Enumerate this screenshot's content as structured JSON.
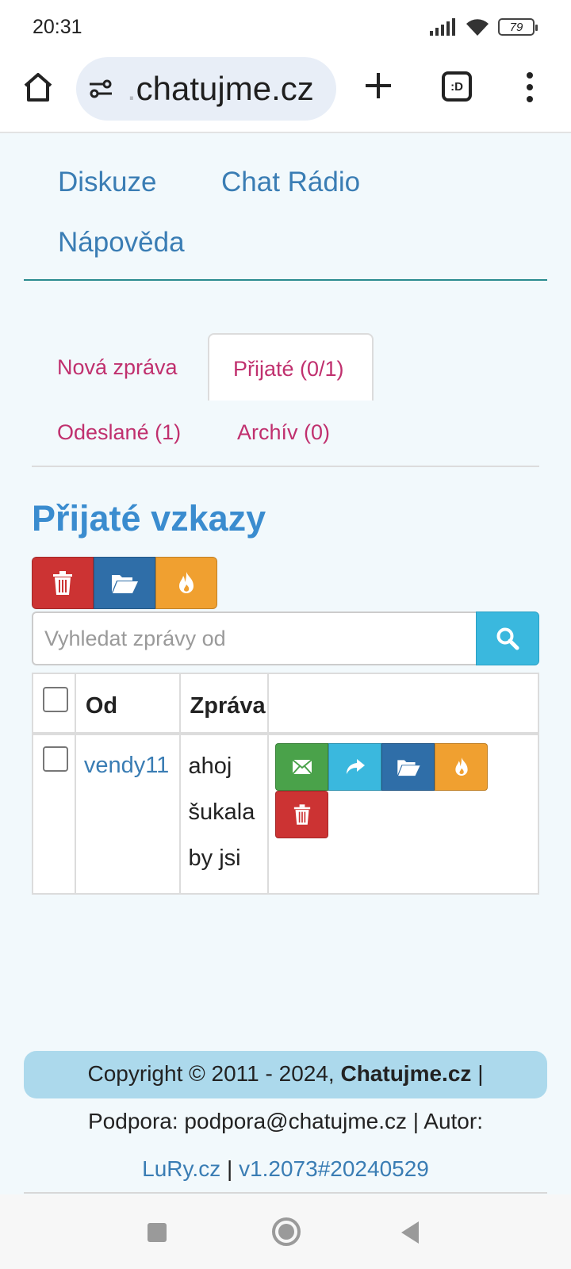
{
  "status_bar": {
    "time": "20:31",
    "battery": "79"
  },
  "browser": {
    "url_faded": ".",
    "url": "chatujme.cz",
    "tabs_label": ":D"
  },
  "site_nav": {
    "items": [
      "Diskuze",
      "Chat Rádio",
      "Nápověda"
    ]
  },
  "message_tabs": {
    "new": "Nová zpráva",
    "received": "Přijaté (0/1)",
    "sent": "Odeslané (1)",
    "archive": "Archív (0)",
    "active": "received"
  },
  "page_title": "Přijaté vzkazy",
  "toolbar": {
    "icons": [
      "trash-icon",
      "folder-open-icon",
      "fire-icon"
    ],
    "colors": [
      "#cc3333",
      "#2f6ea8",
      "#f0a030"
    ]
  },
  "search": {
    "placeholder": "Vyhledat zprávy od",
    "value": ""
  },
  "table": {
    "columns": [
      "",
      "Od",
      "Zpráva",
      ""
    ],
    "rows": [
      {
        "checked": false,
        "from": "vendy11",
        "message_lines": [
          "ahoj",
          "šukala",
          "by jsi"
        ],
        "actions": [
          "envelope-icon",
          "forward-icon",
          "folder-open-icon",
          "fire-icon",
          "trash-icon"
        ]
      }
    ]
  },
  "footer": {
    "copyright_prefix": "Copyright © 2011 - 2024,",
    "site_name": "Chatujme.cz",
    "separator": "|",
    "support": "Podpora: podpora@chatujme.cz | Autor:",
    "author_link": "LuRy.cz",
    "version": "v1.2073#20240529"
  },
  "colors": {
    "link": "#3a7db4",
    "tab_link": "#c0306e",
    "title": "#3a8ccf",
    "background": "#f2f9fc",
    "footer_bar": "#acd9ec"
  }
}
